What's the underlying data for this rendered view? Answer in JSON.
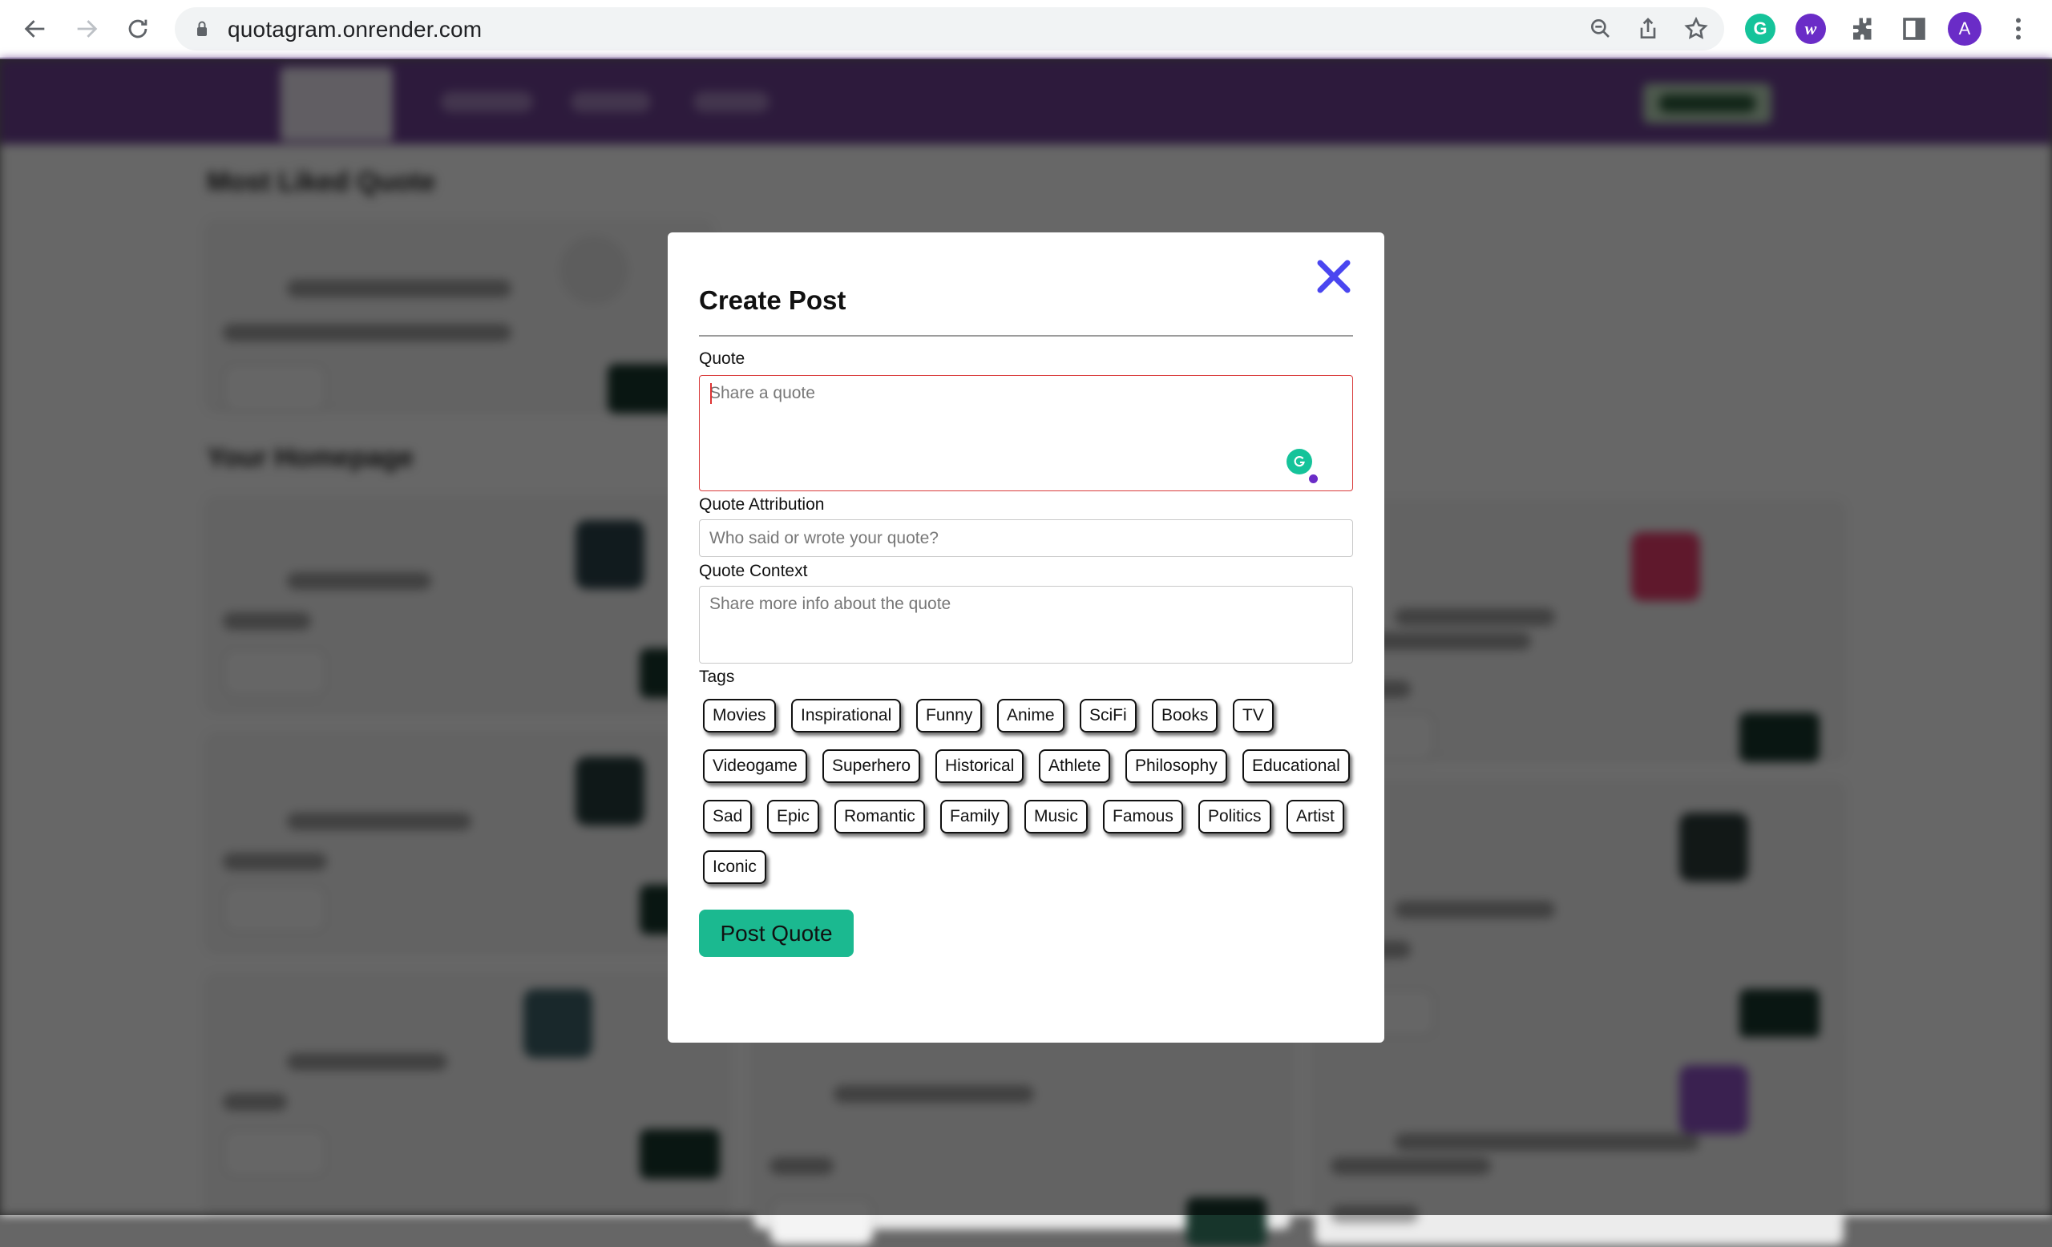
{
  "browser": {
    "url": "quotagram.onrender.com",
    "profile_initial": "A",
    "icons": {
      "back": "arrow-left-icon",
      "forward": "arrow-right-icon",
      "reload": "reload-icon",
      "lock": "lock-icon",
      "zoom": "zoom-out-icon",
      "share": "share-icon",
      "bookmark": "star-icon",
      "grammarly": "grammarly-icon",
      "ext2": "w-extension-icon",
      "extensions": "puzzle-icon",
      "sidepanel": "side-panel-icon",
      "menu": "kebab-menu-icon"
    },
    "colors": {
      "grammarly": "#15c39a",
      "ext_purple": "#6a2cc7",
      "avatar": "#6a2cc7"
    }
  },
  "background_page": {
    "headings": [
      "Most Liked Quote",
      "Your Homepage"
    ],
    "nav_color": "#6b3f8f"
  },
  "modal": {
    "title": "Create Post",
    "close_icon": "close-x-icon",
    "close_color": "#4a46f0",
    "fields": {
      "quote": {
        "label": "Quote",
        "placeholder": "Share a quote",
        "value": ""
      },
      "attribution": {
        "label": "Quote Attribution",
        "placeholder": "Who said or wrote your quote?",
        "value": ""
      },
      "context": {
        "label": "Quote Context",
        "placeholder": "Share more info about the quote",
        "value": ""
      }
    },
    "tags_label": "Tags",
    "tags": [
      "Movies",
      "Inspirational",
      "Funny",
      "Anime",
      "SciFi",
      "Books",
      "TV",
      "Videogame",
      "Superhero",
      "Historical",
      "Athlete",
      "Philosophy",
      "Educational",
      "Sad",
      "Epic",
      "Romantic",
      "Family",
      "Music",
      "Famous",
      "Politics",
      "Artist",
      "Iconic"
    ],
    "submit_label": "Post Quote",
    "submit_color": "#1bb990"
  }
}
